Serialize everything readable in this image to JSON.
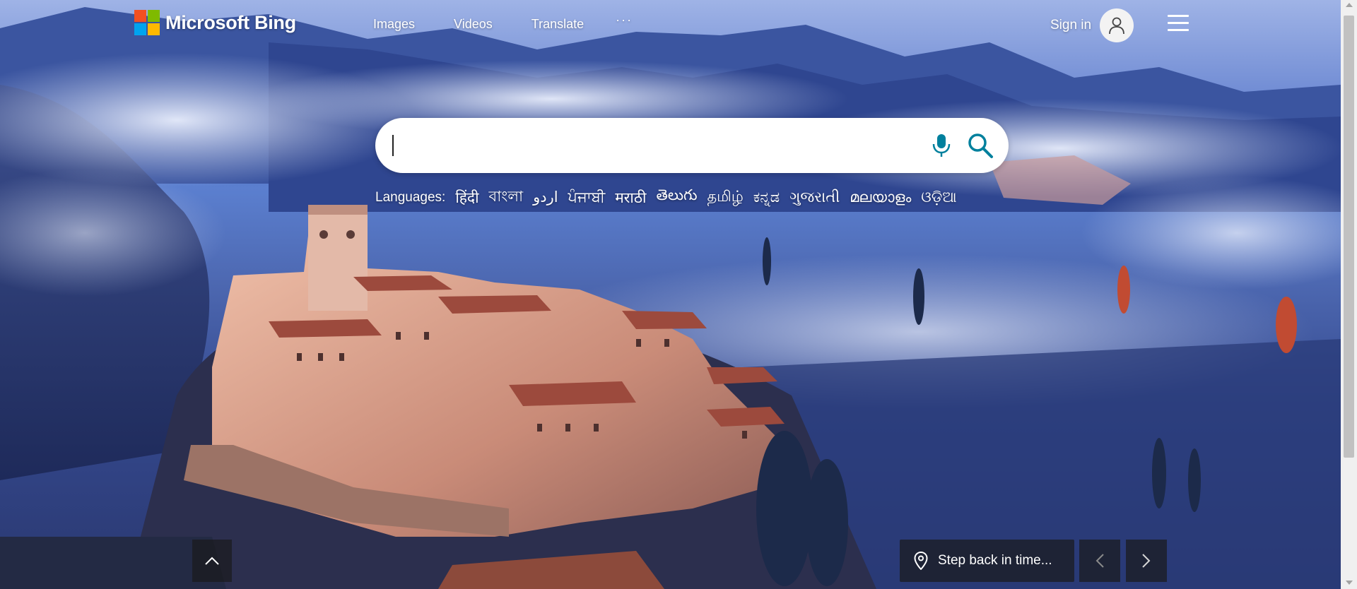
{
  "brand": {
    "name": "Microsoft Bing",
    "logo_colors": [
      "#f25022",
      "#7fba00",
      "#00a4ef",
      "#ffb900"
    ]
  },
  "nav": {
    "items": [
      {
        "label": "Images"
      },
      {
        "label": "Videos"
      },
      {
        "label": "Translate"
      }
    ],
    "more_label": "···"
  },
  "account": {
    "signin_label": "Sign in",
    "avatar_icon": "user-icon"
  },
  "menu_icon": "hamburger-icon",
  "search": {
    "value": "",
    "placeholder": "",
    "mic_icon": "microphone-icon",
    "search_icon": "search-icon",
    "accent_color": "#00809d"
  },
  "languages": {
    "label": "Languages:",
    "items": [
      "हिंदी",
      "বাংলা",
      "اردو",
      "ਪੰਜਾਬੀ",
      "मराठी",
      "తెలుగు",
      "தமிழ்",
      "ಕನ್ನಡ",
      "ગુજરાતી",
      "മലയാളം",
      "ଓଡ଼ିଆ"
    ]
  },
  "image_caption": {
    "text": "Step back in time...",
    "icon": "location-pin-icon"
  },
  "controls": {
    "scroll_up_icon": "chevron-up-icon",
    "prev_icon": "chevron-left-icon",
    "next_icon": "chevron-right-icon"
  }
}
